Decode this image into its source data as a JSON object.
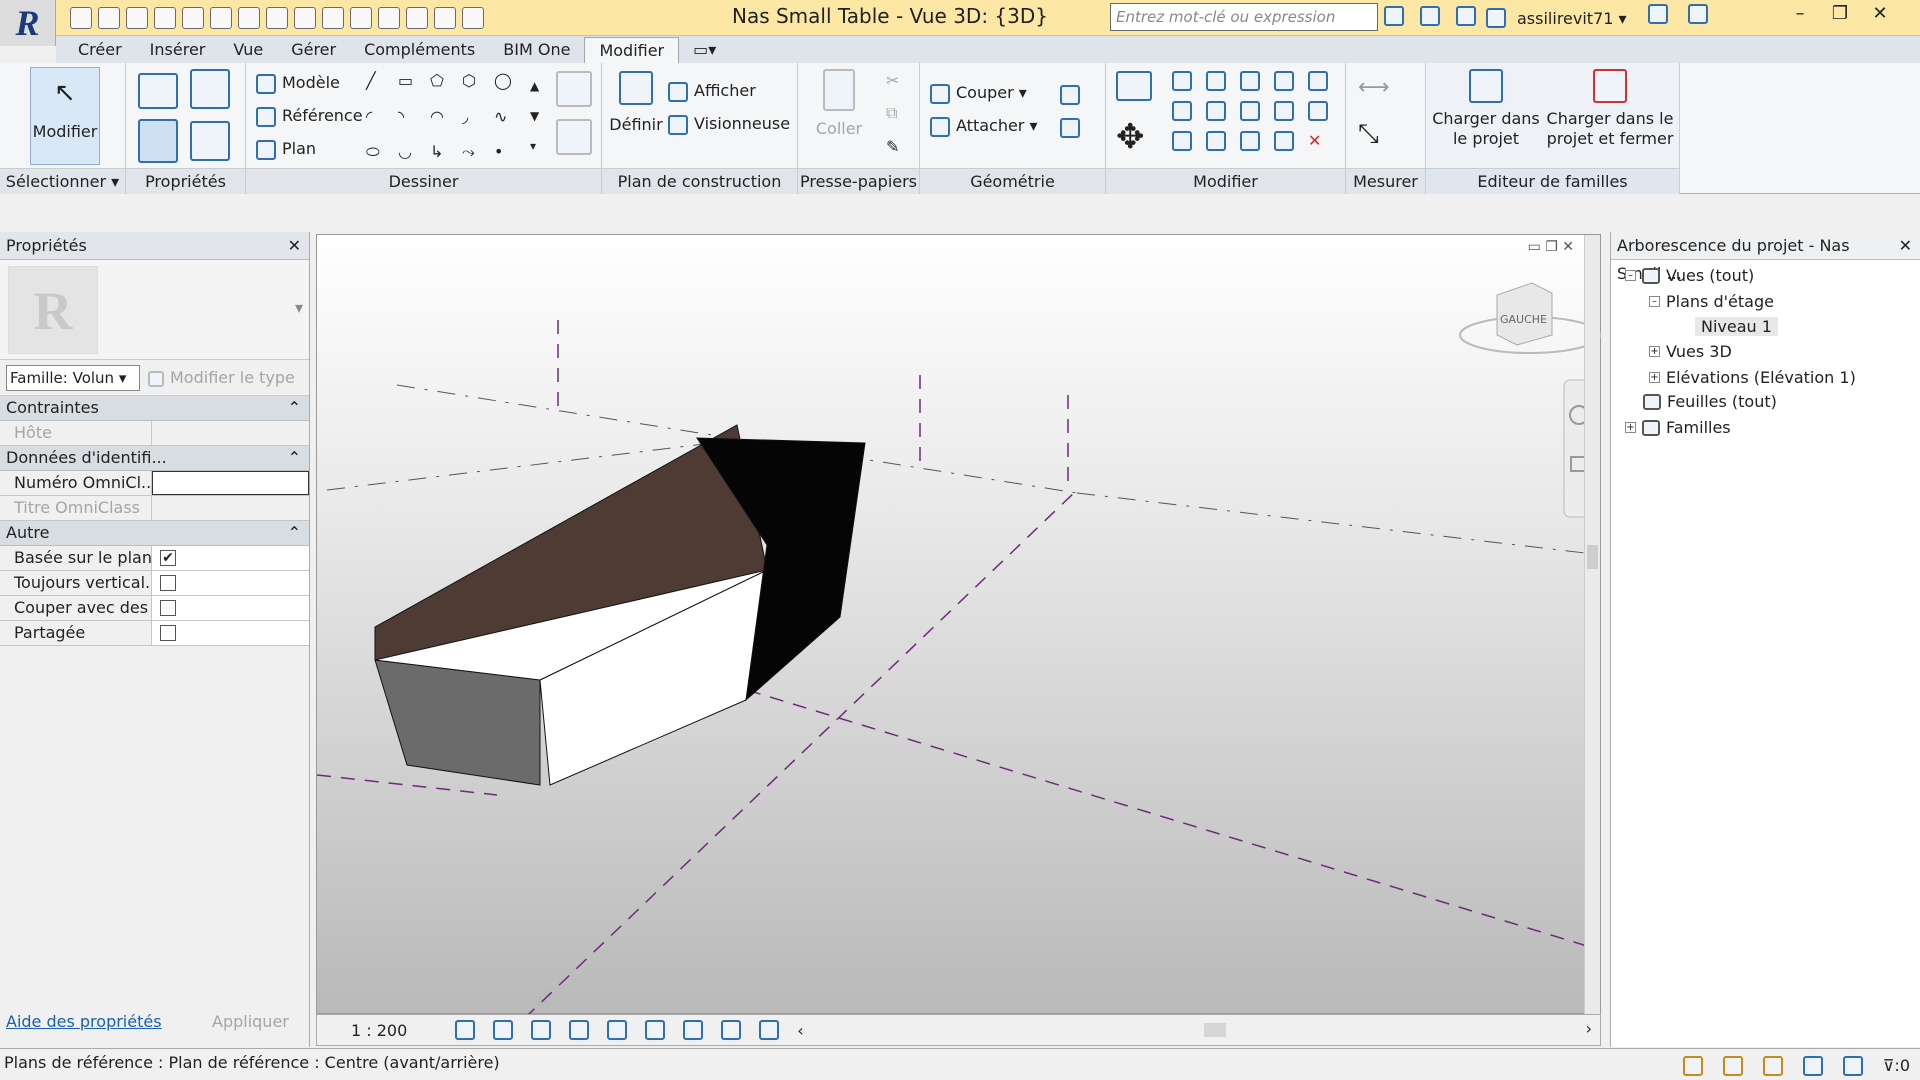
{
  "title": "Nas Small Table - Vue 3D: {3D}",
  "search": {
    "placeholder": "Entrez mot-clé ou expression"
  },
  "user": "assilirevit71",
  "tabs": [
    "Créer",
    "Insérer",
    "Vue",
    "Gérer",
    "Compléments",
    "BIM One",
    "Modifier"
  ],
  "active_tab": "Modifier",
  "ribbon": {
    "select_btn": "Modifier",
    "draw": {
      "modele": "Modèle",
      "reference": "Référence",
      "plan": "Plan"
    },
    "workplane": {
      "definir": "Définir",
      "afficher": "Afficher",
      "visionneuse": "Visionneuse"
    },
    "clipboard": {
      "coller": "Coller"
    },
    "geometry": {
      "couper": "Couper",
      "attacher": "Attacher"
    },
    "family_editor": {
      "load": "Charger dans le projet",
      "load_close": "Charger dans le projet et fermer"
    },
    "panels": [
      "Sélectionner",
      "Propriétés",
      "Dessiner",
      "Plan de construction",
      "Presse-papiers",
      "Géométrie",
      "Modifier",
      "Mesurer",
      "Editeur de familles"
    ]
  },
  "properties": {
    "title": "Propriétés",
    "family_select": "Famille: Volun",
    "edit_type": "Modifier le type",
    "categories": [
      {
        "name": "Contraintes",
        "rows": [
          {
            "key": "Hôte",
            "value": "",
            "greyed": true
          }
        ]
      },
      {
        "name": "Données d'identifi...",
        "rows": [
          {
            "key": "Numéro OmniCl...",
            "value": ""
          },
          {
            "key": "Titre OmniClass",
            "value": "",
            "greyed": true
          }
        ]
      },
      {
        "name": "Autre",
        "rows": [
          {
            "key": "Basée sur le plan ...",
            "checked": true
          },
          {
            "key": "Toujours vertical...",
            "checked": false
          },
          {
            "key": "Couper avec des ...",
            "checked": false
          },
          {
            "key": "Partagée",
            "checked": false
          }
        ]
      }
    ],
    "help_link": "Aide des propriétés",
    "apply": "Appliquer"
  },
  "viewcube_label": "GAUCHE",
  "view_scale": "1 : 200",
  "browser": {
    "title": "Arborescence du projet - Nas Small ...",
    "items": [
      "Vues (tout)",
      "Plans d'étage",
      "Niveau 1",
      "Vues 3D",
      "Elévations (Elévation 1)",
      "Feuilles (tout)",
      "Familles"
    ]
  },
  "status": "Plans de référence : Plan de référence : Centre (avant/arrière)",
  "filter_count": ":0",
  "colors": {
    "titlebar": "#fde7a4",
    "shape_brown": "#4e3b33",
    "shape_black": "#050505",
    "shape_grey": "#6b6b6b",
    "refplane": "#6e2a78"
  }
}
